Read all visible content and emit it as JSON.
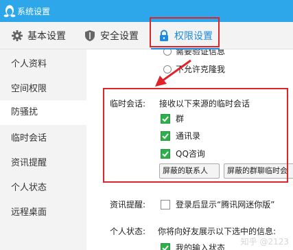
{
  "window": {
    "title": "系统设置"
  },
  "tabs": [
    {
      "label": "基本设置",
      "icon": "gear-icon"
    },
    {
      "label": "安全设置",
      "icon": "shield-icon"
    },
    {
      "label": "权限设置",
      "icon": "lock-icon"
    }
  ],
  "sidebar": {
    "items": [
      {
        "label": "个人资料"
      },
      {
        "label": "空间权限"
      },
      {
        "label": "防骚扰"
      },
      {
        "label": "临时会话"
      },
      {
        "label": "资讯提醒"
      },
      {
        "label": "个人状态"
      },
      {
        "label": "远程桌面"
      }
    ],
    "active_index": 2
  },
  "anti_harass": {
    "option_partial": "需要验证信息",
    "option_no_clone": "不允许克隆我"
  },
  "temp_session": {
    "label": "临时会话:",
    "heading": "接收以下来源的临时会话",
    "options": [
      {
        "label": "群",
        "checked": true
      },
      {
        "label": "通讯录",
        "checked": true
      },
      {
        "label": "QQ咨询",
        "checked": true
      }
    ],
    "buttons": {
      "blocked_contacts": "屏蔽的联系人",
      "blocked_group_chats": "屏蔽的群聊临时会"
    }
  },
  "news_reminder": {
    "label": "资讯提醒:",
    "option": "登录后显示“腾讯网迷你版”",
    "checked": false
  },
  "personal_status": {
    "label": "个人状态:",
    "text": "你将向好友展示以下选中的信息:",
    "option": "我的输入状态"
  },
  "watermark": "知乎 @2123",
  "colors": {
    "titlebar": "#2ea7ea",
    "accent": "#1d8ae0",
    "highlight": "#e0222b",
    "check": "#2db04a"
  }
}
